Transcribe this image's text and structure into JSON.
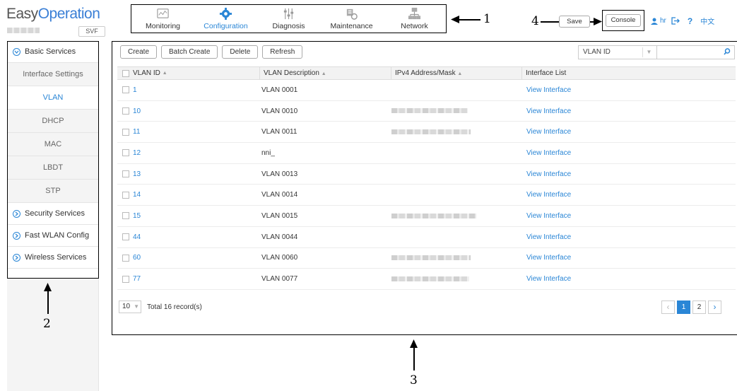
{
  "logo": {
    "easy": "Easy",
    "operation": "Operation",
    "svf": "SVF"
  },
  "nav": [
    {
      "label": "Monitoring",
      "icon": "monitor-chart-icon"
    },
    {
      "label": "Configuration",
      "icon": "gear-icon",
      "active": true
    },
    {
      "label": "Diagnosis",
      "icon": "sliders-icon"
    },
    {
      "label": "Maintenance",
      "icon": "tools-icon"
    },
    {
      "label": "Network",
      "icon": "network-topology-icon"
    }
  ],
  "annotations": {
    "a1": "1",
    "a2": "2",
    "a3": "3",
    "a4": "4"
  },
  "header": {
    "save_label": "Save",
    "console_label": "Console",
    "user": "hr",
    "help": "?",
    "language": "中文"
  },
  "sidebar": {
    "groups": [
      {
        "label": "Basic Services",
        "expanded": true,
        "items": [
          "Interface Settings",
          "VLAN",
          "DHCP",
          "MAC",
          "LBDT",
          "STP"
        ]
      },
      {
        "label": "Security Services"
      },
      {
        "label": "Fast WLAN Config"
      },
      {
        "label": "Wireless Services"
      }
    ]
  },
  "toolbar": {
    "create": "Create",
    "batch_create": "Batch Create",
    "delete": "Delete",
    "refresh": "Refresh"
  },
  "filter": {
    "field": "VLAN ID",
    "value": ""
  },
  "table": {
    "headers": [
      "VLAN ID",
      "VLAN Description",
      "IPv4 Address/Mask",
      "Interface List"
    ],
    "rows": [
      {
        "id": "1",
        "desc": "VLAN 0001",
        "link": "View Interface"
      },
      {
        "id": "10",
        "desc": "VLAN 0010",
        "link": "View Interface"
      },
      {
        "id": "11",
        "desc": "VLAN 0011",
        "link": "View Interface"
      },
      {
        "id": "12",
        "desc": "nni_",
        "link": "View Interface"
      },
      {
        "id": "13",
        "desc": "VLAN 0013",
        "link": "View Interface"
      },
      {
        "id": "14",
        "desc": "VLAN 0014",
        "link": "View Interface"
      },
      {
        "id": "15",
        "desc": "VLAN 0015",
        "link": "View Interface"
      },
      {
        "id": "44",
        "desc": "VLAN 0044",
        "link": "View Interface"
      },
      {
        "id": "60",
        "desc": "VLAN 0060",
        "link": "View Interface"
      },
      {
        "id": "77",
        "desc": "VLAN 0077",
        "link": "View Interface"
      }
    ]
  },
  "pagination": {
    "page_size": "10",
    "total": "Total 16 record(s)",
    "pages": [
      "1",
      "2"
    ],
    "current": "1"
  },
  "colors": {
    "accent": "#2a86d6"
  }
}
